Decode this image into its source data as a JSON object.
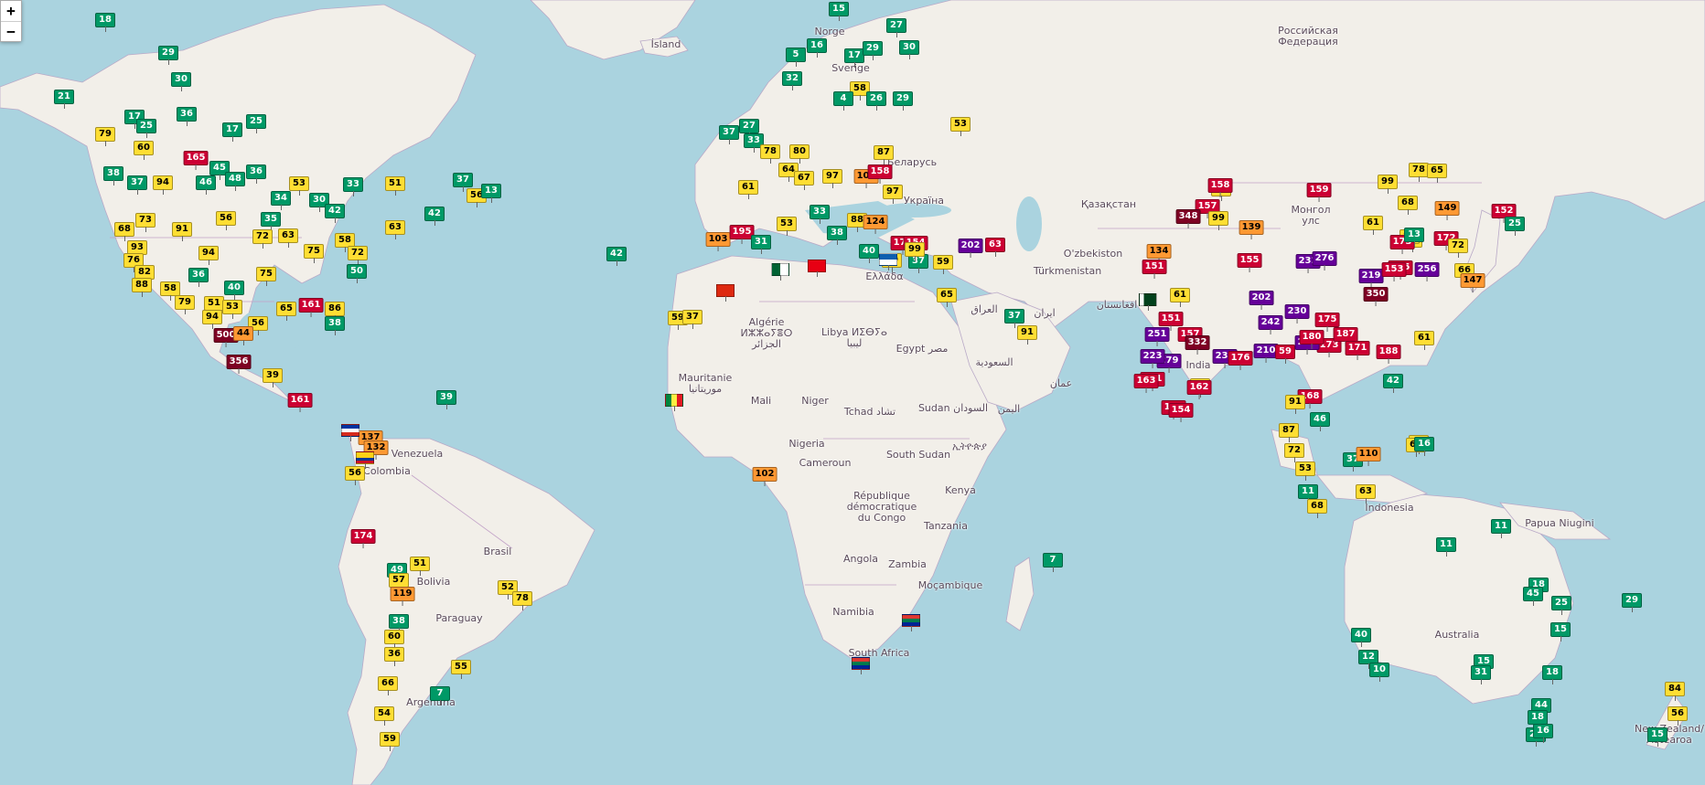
{
  "zoom": {
    "in_label": "+",
    "out_label": "−"
  },
  "aqi_colors": {
    "good": "#009966",
    "moderate": "#ffde33",
    "sensitive": "#ff9933",
    "unhealthy": "#cc0033",
    "very_unhealthy": "#660099",
    "hazardous": "#7e0023"
  },
  "labels": [
    {
      "name": "label-iceland",
      "text": "Ísland"
    },
    {
      "name": "label-norge",
      "text": "Norge"
    },
    {
      "name": "label-sverige",
      "text": "Sverige"
    },
    {
      "name": "label-russia",
      "text": "Российская\nФедерация"
    },
    {
      "name": "label-belarus",
      "text": "Беларусь"
    },
    {
      "name": "label-ukraine",
      "text": "Україна"
    },
    {
      "name": "label-kazakhstan",
      "text": "Қазақстан"
    },
    {
      "name": "label-mongolia",
      "text": "Монгол\nулс"
    },
    {
      "name": "label-uzbekistan",
      "text": "O'zbekiston"
    },
    {
      "name": "label-turkmenistan",
      "text": "Türkmenistan"
    },
    {
      "name": "label-greece",
      "text": "Ελλάδα"
    },
    {
      "name": "label-iran",
      "text": "ایران"
    },
    {
      "name": "label-afghanistan",
      "text": "افغانستان"
    },
    {
      "name": "label-iraq",
      "text": "العراق"
    },
    {
      "name": "label-saudi",
      "text": "السعودية"
    },
    {
      "name": "label-oman",
      "text": "عمان"
    },
    {
      "name": "label-yemen",
      "text": "اليمن"
    },
    {
      "name": "label-algeria",
      "text": "Algérie\nⵍⵣⵣⴰⵢⴻⵔ\nالجزائر"
    },
    {
      "name": "label-libya",
      "text": "Libya ⵍⵉⴱⵢⴰ\nليبيا"
    },
    {
      "name": "label-egypt",
      "text": "Egypt مصر"
    },
    {
      "name": "label-mauritanie",
      "text": "Mauritanie\nموريتانيا"
    },
    {
      "name": "label-mali",
      "text": "Mali"
    },
    {
      "name": "label-niger",
      "text": "Niger"
    },
    {
      "name": "label-tchad",
      "text": "Tchad تشاد"
    },
    {
      "name": "label-sudan",
      "text": "Sudan السودان"
    },
    {
      "name": "label-ethiopia",
      "text": "ኢትዮጵያ"
    },
    {
      "name": "label-nigeria",
      "text": "Nigeria"
    },
    {
      "name": "label-cameroun",
      "text": "Cameroun"
    },
    {
      "name": "label-south-sudan",
      "text": "South Sudan"
    },
    {
      "name": "label-drc",
      "text": "République\ndémocratique\ndu Congo"
    },
    {
      "name": "label-kenya",
      "text": "Kenya"
    },
    {
      "name": "label-tanzania",
      "text": "Tanzania"
    },
    {
      "name": "label-angola",
      "text": "Angola"
    },
    {
      "name": "label-zambia",
      "text": "Zambia"
    },
    {
      "name": "label-mocambique",
      "text": "Moçambique"
    },
    {
      "name": "label-namibia",
      "text": "Namibia"
    },
    {
      "name": "label-south-africa",
      "text": "South Africa"
    },
    {
      "name": "label-venezuela",
      "text": "Venezuela"
    },
    {
      "name": "label-colombia",
      "text": "Colombia"
    },
    {
      "name": "label-brasil",
      "text": "Brasil"
    },
    {
      "name": "label-bolivia",
      "text": "Bolivia"
    },
    {
      "name": "label-paraguay",
      "text": "Paraguay"
    },
    {
      "name": "label-argentina",
      "text": "Argentina"
    },
    {
      "name": "label-india",
      "text": "India"
    },
    {
      "name": "label-indonesia",
      "text": "Indonesia"
    },
    {
      "name": "label-papua",
      "text": "Papua Niugini"
    },
    {
      "name": "label-australia",
      "text": "Australia"
    },
    {
      "name": "label-nz",
      "text": "New Zealand/\nAotearoa"
    }
  ],
  "markers": [
    [
      "18",
      "good"
    ],
    [
      "29",
      "good"
    ],
    [
      "30",
      "good"
    ],
    [
      "21",
      "good"
    ],
    [
      "17",
      "good"
    ],
    [
      "25",
      "good"
    ],
    [
      "79",
      "moderate"
    ],
    [
      "60",
      "moderate"
    ],
    [
      "36",
      "good"
    ],
    [
      "165",
      "unhealthy"
    ],
    [
      "17",
      "good"
    ],
    [
      "25",
      "good"
    ],
    [
      "38",
      "good"
    ],
    [
      "37",
      "good"
    ],
    [
      "94",
      "moderate"
    ],
    [
      "45",
      "good"
    ],
    [
      "46",
      "good"
    ],
    [
      "48",
      "good"
    ],
    [
      "36",
      "good"
    ],
    [
      "53",
      "moderate"
    ],
    [
      "33",
      "good"
    ],
    [
      "37",
      "good"
    ],
    [
      "56",
      "moderate"
    ],
    [
      "13",
      "good"
    ],
    [
      "42",
      "good"
    ],
    [
      "68",
      "moderate"
    ],
    [
      "73",
      "moderate"
    ],
    [
      "91",
      "moderate"
    ],
    [
      "56",
      "moderate"
    ],
    [
      "35",
      "good"
    ],
    [
      "34",
      "good"
    ],
    [
      "30",
      "good"
    ],
    [
      "42",
      "good"
    ],
    [
      "51",
      "moderate"
    ],
    [
      "63",
      "moderate"
    ],
    [
      "93",
      "moderate"
    ],
    [
      "76",
      "moderate"
    ],
    [
      "82",
      "moderate"
    ],
    [
      "94",
      "moderate"
    ],
    [
      "72",
      "moderate"
    ],
    [
      "63",
      "moderate"
    ],
    [
      "75",
      "moderate"
    ],
    [
      "58",
      "moderate"
    ],
    [
      "72",
      "moderate"
    ],
    [
      "88",
      "moderate"
    ],
    [
      "58",
      "moderate"
    ],
    [
      "79",
      "moderate"
    ],
    [
      "51",
      "moderate"
    ],
    [
      "36",
      "good"
    ],
    [
      "40",
      "good"
    ],
    [
      "53",
      "moderate"
    ],
    [
      "75",
      "moderate"
    ],
    [
      "50",
      "good"
    ],
    [
      "94",
      "moderate"
    ],
    [
      "56",
      "moderate"
    ],
    [
      "65",
      "moderate"
    ],
    [
      "161",
      "unhealthy"
    ],
    [
      "86",
      "moderate"
    ],
    [
      "38",
      "good"
    ],
    [
      "500",
      "hazardous"
    ],
    [
      "44",
      "sensitive"
    ],
    [
      "356",
      "hazardous"
    ],
    [
      "39",
      "moderate"
    ],
    [
      "161",
      "unhealthy"
    ],
    [
      "39",
      "good"
    ],
    [
      "137",
      "sensitive"
    ],
    [
      "132",
      "sensitive"
    ],
    [
      "56",
      "moderate"
    ],
    [
      "174",
      "unhealthy"
    ],
    [
      "49",
      "good"
    ],
    [
      "51",
      "moderate"
    ],
    [
      "57",
      "moderate"
    ],
    [
      "119",
      "sensitive"
    ],
    [
      "38",
      "good"
    ],
    [
      "60",
      "moderate"
    ],
    [
      "36",
      "moderate"
    ],
    [
      "66",
      "moderate"
    ],
    [
      "54",
      "moderate"
    ],
    [
      "59",
      "moderate"
    ],
    [
      "55",
      "moderate"
    ],
    [
      "7",
      "good"
    ],
    [
      "52",
      "moderate"
    ],
    [
      "78",
      "moderate"
    ],
    [
      "42",
      "good"
    ],
    [
      "102",
      "sensitive"
    ],
    [
      "59",
      "moderate"
    ],
    [
      "37",
      "moderate"
    ],
    [
      "15",
      "good"
    ],
    [
      "27",
      "good"
    ],
    [
      "16",
      "good"
    ],
    [
      "5",
      "good"
    ],
    [
      "17",
      "good"
    ],
    [
      "29",
      "good"
    ],
    [
      "30",
      "good"
    ],
    [
      "32",
      "good"
    ],
    [
      "58",
      "moderate"
    ],
    [
      "4",
      "good"
    ],
    [
      "26",
      "good"
    ],
    [
      "29",
      "good"
    ],
    [
      "53",
      "moderate"
    ],
    [
      "37",
      "good"
    ],
    [
      "27",
      "good"
    ],
    [
      "33",
      "good"
    ],
    [
      "78",
      "moderate"
    ],
    [
      "80",
      "moderate"
    ],
    [
      "64",
      "moderate"
    ],
    [
      "87",
      "moderate"
    ],
    [
      "61",
      "moderate"
    ],
    [
      "67",
      "moderate"
    ],
    [
      "97",
      "moderate"
    ],
    [
      "107",
      "sensitive"
    ],
    [
      "158",
      "unhealthy"
    ],
    [
      "97",
      "moderate"
    ],
    [
      "53",
      "moderate"
    ],
    [
      "33",
      "good"
    ],
    [
      "88",
      "moderate"
    ],
    [
      "124",
      "sensitive"
    ],
    [
      "179",
      "unhealthy"
    ],
    [
      "154",
      "unhealthy"
    ],
    [
      "202",
      "very_unhealthy"
    ],
    [
      "63",
      "unhealthy"
    ],
    [
      "103",
      "sensitive"
    ],
    [
      "195",
      "unhealthy"
    ],
    [
      "31",
      "good"
    ],
    [
      "38",
      "good"
    ],
    [
      "40",
      "good"
    ],
    [
      "70",
      "moderate"
    ],
    [
      "37",
      "good"
    ],
    [
      "59",
      "moderate"
    ],
    [
      "99",
      "moderate"
    ],
    [
      "65",
      "moderate"
    ],
    [
      "37",
      "good"
    ],
    [
      "91",
      "moderate"
    ],
    [
      "63",
      "moderate"
    ],
    [
      "157",
      "unhealthy"
    ],
    [
      "99",
      "moderate"
    ],
    [
      "139",
      "sensitive"
    ],
    [
      "348",
      "hazardous"
    ],
    [
      "155",
      "unhealthy"
    ],
    [
      "134",
      "sensitive"
    ],
    [
      "151",
      "unhealthy"
    ],
    [
      "158",
      "unhealthy"
    ],
    [
      "159",
      "unhealthy"
    ],
    [
      "99",
      "moderate"
    ],
    [
      "78",
      "moderate"
    ],
    [
      "65",
      "moderate"
    ],
    [
      "68",
      "moderate"
    ],
    [
      "149",
      "sensitive"
    ],
    [
      "61",
      "moderate"
    ],
    [
      "80",
      "moderate"
    ],
    [
      "85",
      "moderate"
    ],
    [
      "173",
      "unhealthy"
    ],
    [
      "185",
      "unhealthy"
    ],
    [
      "232",
      "very_unhealthy"
    ],
    [
      "276",
      "very_unhealthy"
    ],
    [
      "219",
      "very_unhealthy"
    ],
    [
      "153",
      "unhealthy"
    ],
    [
      "350",
      "hazardous"
    ],
    [
      "256",
      "very_unhealthy"
    ],
    [
      "172",
      "unhealthy"
    ],
    [
      "72",
      "moderate"
    ],
    [
      "66",
      "moderate"
    ],
    [
      "147",
      "sensitive"
    ],
    [
      "152",
      "unhealthy"
    ],
    [
      "25",
      "good"
    ],
    [
      "13",
      "good"
    ],
    [
      "61",
      "moderate"
    ],
    [
      "151",
      "unhealthy"
    ],
    [
      "251",
      "very_unhealthy"
    ],
    [
      "157",
      "unhealthy"
    ],
    [
      "279",
      "very_unhealthy"
    ],
    [
      "230",
      "very_unhealthy"
    ],
    [
      "210",
      "very_unhealthy"
    ],
    [
      "59",
      "unhealthy"
    ],
    [
      "176",
      "unhealthy"
    ],
    [
      "223",
      "very_unhealthy"
    ],
    [
      "332",
      "hazardous"
    ],
    [
      "161",
      "unhealthy"
    ],
    [
      "163",
      "unhealthy"
    ],
    [
      "80",
      "moderate"
    ],
    [
      "161",
      "unhealthy"
    ],
    [
      "154",
      "unhealthy"
    ],
    [
      "162",
      "unhealthy"
    ],
    [
      "202",
      "very_unhealthy"
    ],
    [
      "230",
      "very_unhealthy"
    ],
    [
      "242",
      "very_unhealthy"
    ],
    [
      "175",
      "unhealthy"
    ],
    [
      "173",
      "unhealthy"
    ],
    [
      "218",
      "very_unhealthy"
    ],
    [
      "187",
      "unhealthy"
    ],
    [
      "171",
      "unhealthy"
    ],
    [
      "180",
      "unhealthy"
    ],
    [
      "188",
      "unhealthy"
    ],
    [
      "168",
      "unhealthy"
    ],
    [
      "91",
      "moderate"
    ],
    [
      "46",
      "good"
    ],
    [
      "42",
      "good"
    ],
    [
      "61",
      "moderate"
    ],
    [
      "87",
      "moderate"
    ],
    [
      "72",
      "moderate"
    ],
    [
      "53",
      "moderate"
    ],
    [
      "37",
      "good"
    ],
    [
      "110",
      "sensitive"
    ],
    [
      "11",
      "good"
    ],
    [
      "63",
      "moderate"
    ],
    [
      "68",
      "moderate"
    ],
    [
      "65",
      "moderate"
    ],
    [
      "60",
      "moderate"
    ],
    [
      "16",
      "good"
    ],
    [
      "7",
      "good"
    ],
    [
      "11",
      "good"
    ],
    [
      "11",
      "good"
    ],
    [
      "18",
      "good"
    ],
    [
      "45",
      "good"
    ],
    [
      "25",
      "good"
    ],
    [
      "15",
      "good"
    ],
    [
      "29",
      "good"
    ],
    [
      "40",
      "good"
    ],
    [
      "12",
      "good"
    ],
    [
      "10",
      "good"
    ],
    [
      "15",
      "good"
    ],
    [
      "31",
      "good"
    ],
    [
      "18",
      "good"
    ],
    [
      "44",
      "good"
    ],
    [
      "18",
      "good"
    ],
    [
      "21",
      "good"
    ],
    [
      "16",
      "good"
    ],
    [
      "84",
      "moderate"
    ],
    [
      "56",
      "moderate"
    ],
    [
      "15",
      "good"
    ]
  ]
}
